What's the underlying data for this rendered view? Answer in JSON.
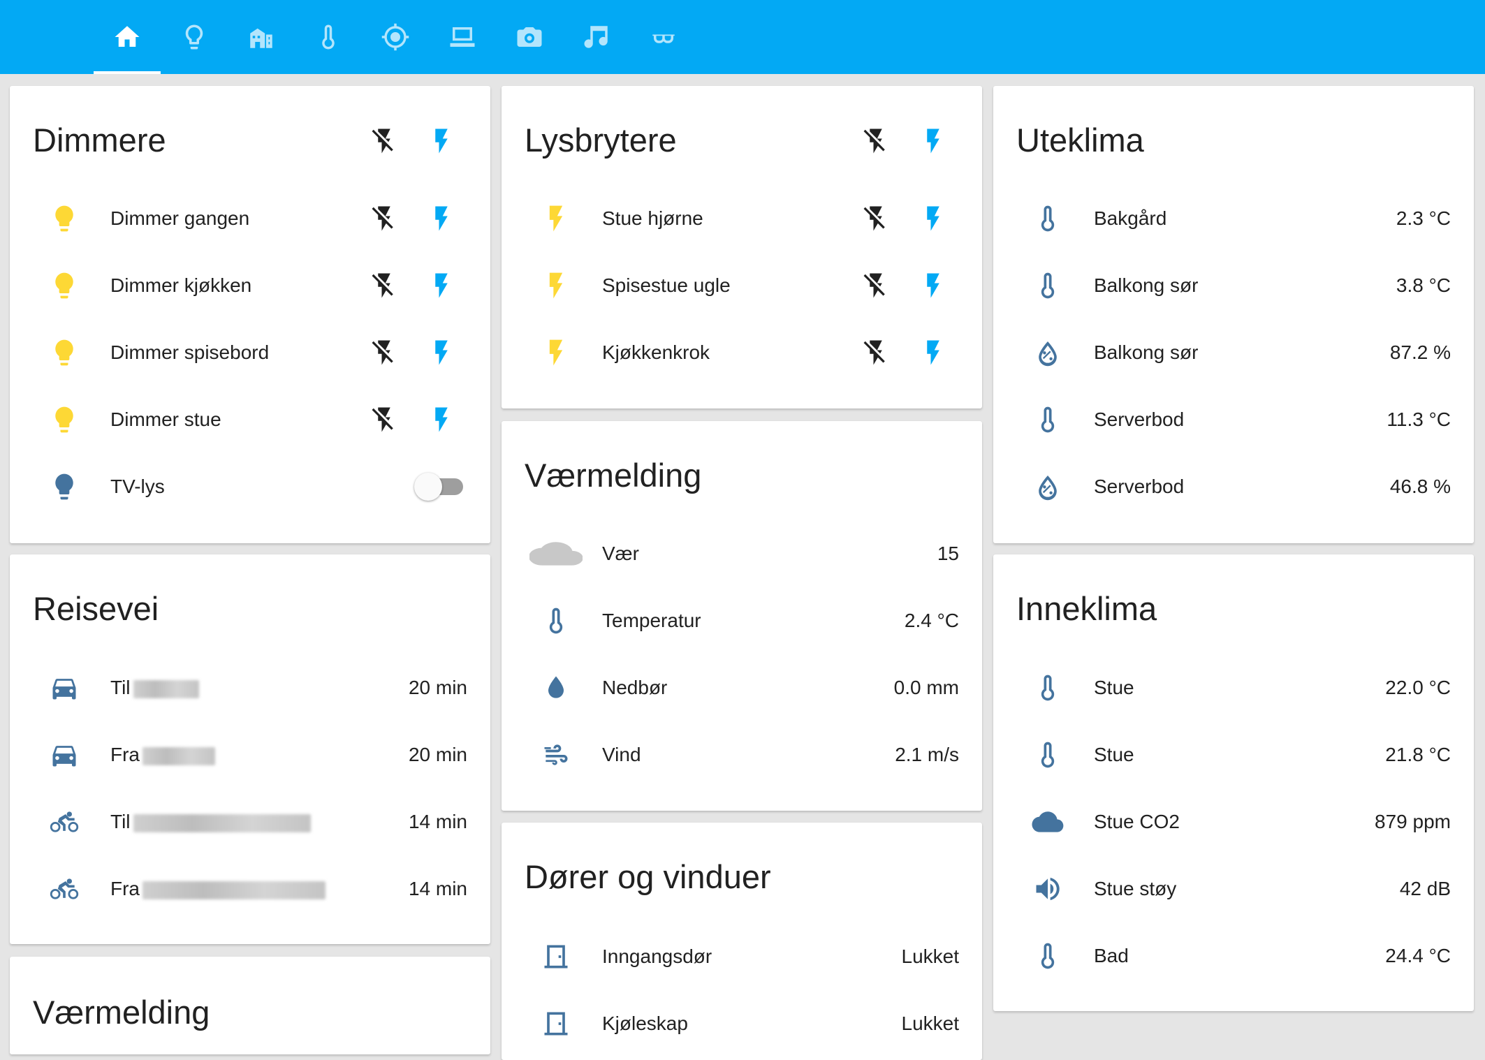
{
  "tabs": [
    {
      "icon": "home-icon",
      "active": true
    },
    {
      "icon": "lightbulb-icon"
    },
    {
      "icon": "building-icon"
    },
    {
      "icon": "thermometer-icon"
    },
    {
      "icon": "crosshairs-gps-icon"
    },
    {
      "icon": "laptop-icon"
    },
    {
      "icon": "camera-icon"
    },
    {
      "icon": "music-note-icon"
    },
    {
      "icon": "glasses-icon"
    }
  ],
  "colors": {
    "accent": "#03a9f4",
    "light_on": "#fdd835",
    "state_icon": "#44739e",
    "flash_on": "#03a9f4"
  },
  "dimmere": {
    "title": "Dimmere",
    "items": [
      {
        "name": "Dimmer gangen",
        "icon": "lightbulb-icon"
      },
      {
        "name": "Dimmer kjøkken",
        "icon": "lightbulb-icon"
      },
      {
        "name": "Dimmer spisebord",
        "icon": "lightbulb-icon"
      },
      {
        "name": "Dimmer stue",
        "icon": "lightbulb-icon"
      },
      {
        "name": "TV-lys",
        "icon": "lightbulb-icon",
        "state": "off"
      }
    ]
  },
  "reisevei": {
    "title": "Reisevei",
    "items": [
      {
        "name": "Til",
        "icon": "car-icon",
        "value": "20 min"
      },
      {
        "name": "Fra",
        "icon": "car-icon",
        "value": "20 min"
      },
      {
        "name": "Til",
        "icon": "motorbike-icon",
        "value": "14 min"
      },
      {
        "name": "Fra",
        "icon": "motorbike-icon",
        "value": "14 min"
      }
    ]
  },
  "varmelding_left": {
    "title": "Værmelding"
  },
  "lysbrytere": {
    "title": "Lysbrytere",
    "items": [
      {
        "name": "Stue hjørne",
        "icon": "flash-icon"
      },
      {
        "name": "Spisestue ugle",
        "icon": "flash-icon"
      },
      {
        "name": "Kjøkkenkrok",
        "icon": "flash-icon"
      }
    ]
  },
  "varmelding": {
    "title": "Værmelding",
    "items": [
      {
        "name": "Vær",
        "icon": "cloud-icon",
        "value": "15"
      },
      {
        "name": "Temperatur",
        "icon": "thermometer-icon",
        "value": "2.4 °C"
      },
      {
        "name": "Nedbør",
        "icon": "water-drop-icon",
        "value": "0.0 mm"
      },
      {
        "name": "Vind",
        "icon": "weather-windy-icon",
        "value": "2.1 m/s"
      }
    ]
  },
  "dorer": {
    "title": "Dører og vinduer",
    "items": [
      {
        "name": "Inngangsdør",
        "icon": "door-closed-icon",
        "value": "Lukket"
      },
      {
        "name": "Kjøleskap",
        "icon": "door-closed-icon",
        "value": "Lukket"
      }
    ]
  },
  "uteklima": {
    "title": "Uteklima",
    "items": [
      {
        "name": "Bakgård",
        "icon": "thermometer-icon",
        "value": "2.3 °C"
      },
      {
        "name": "Balkong sør",
        "icon": "thermometer-icon",
        "value": "3.8 °C"
      },
      {
        "name": "Balkong sør",
        "icon": "water-percent-icon",
        "value": "87.2 %"
      },
      {
        "name": "Serverbod",
        "icon": "thermometer-icon",
        "value": "11.3 °C"
      },
      {
        "name": "Serverbod",
        "icon": "water-percent-icon",
        "value": "46.8 %"
      }
    ]
  },
  "inneklima": {
    "title": "Inneklima",
    "items": [
      {
        "name": "Stue",
        "icon": "thermometer-icon",
        "value": "22.0 °C"
      },
      {
        "name": "Stue",
        "icon": "thermometer-icon",
        "value": "21.8 °C"
      },
      {
        "name": "Stue CO2",
        "icon": "cloud-icon",
        "value": "879 ppm"
      },
      {
        "name": "Stue støy",
        "icon": "volume-high-icon",
        "value": "42 dB"
      },
      {
        "name": "Bad",
        "icon": "thermometer-icon",
        "value": "24.4 °C"
      }
    ]
  }
}
